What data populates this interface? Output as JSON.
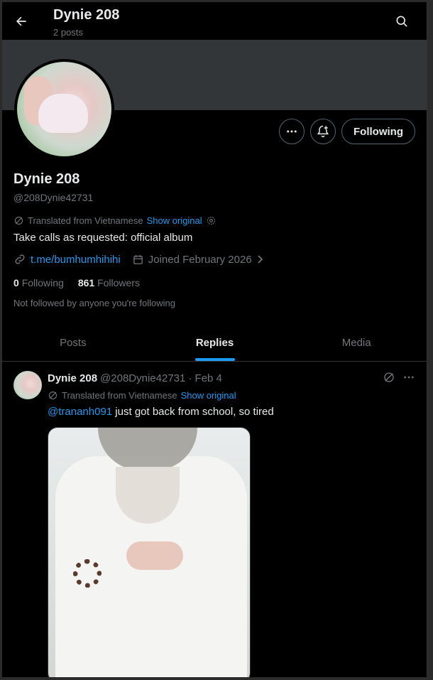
{
  "header": {
    "title": "Dynie 208",
    "subtitle": "2 posts"
  },
  "profile": {
    "name": "Dynie 208",
    "handle": "@208Dynie42731",
    "translated_from": "Translated from Vietnamese",
    "show_original": "Show original",
    "bio": "Take calls as requested: official album",
    "link": "t.me/bumhumhihihi",
    "joined": "Joined February 2026",
    "following_count": "0",
    "following_label": "Following",
    "followers_count": "861",
    "followers_label": "Followers",
    "not_followed": "Not followed by anyone you're following",
    "following_button": "Following"
  },
  "tabs": [
    {
      "label": "Posts",
      "active": false
    },
    {
      "label": "Replies",
      "active": true
    },
    {
      "label": "Media",
      "active": false
    }
  ],
  "post": {
    "name": "Dynie 208",
    "handle": "@208Dynie42731",
    "date": "· Feb 4",
    "translated_from": "Translated from Vietnamese",
    "show_original": "Show original",
    "mention": "@trananh091",
    "text": " just got back from school, so tired"
  },
  "icons": {
    "back": "arrow-left-icon",
    "search": "search-icon",
    "more": "more-icon",
    "notify": "bell-plus-icon",
    "translate": "translate-icon",
    "settings": "gear-icon",
    "link": "link-icon",
    "calendar": "calendar-icon",
    "chevron": "chevron-right-icon"
  },
  "colors": {
    "accent": "#1d9bf0",
    "muted": "#71767b",
    "text": "#e7e9ea"
  }
}
